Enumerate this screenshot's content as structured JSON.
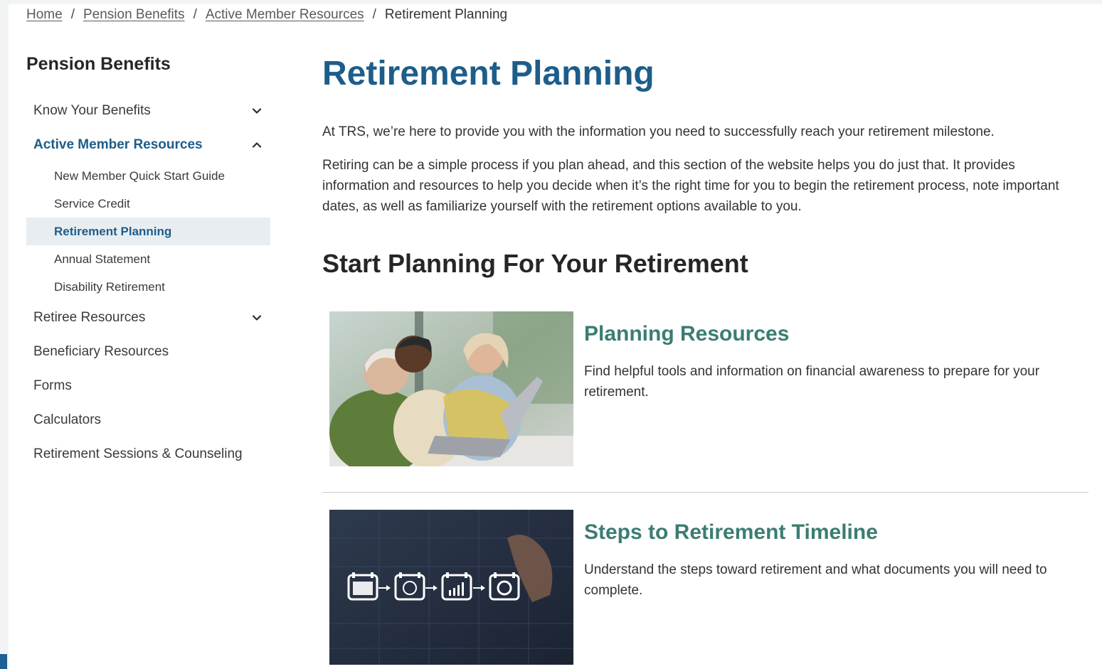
{
  "breadcrumb": {
    "items": [
      "Home",
      "Pension Benefits",
      "Active Member Resources"
    ],
    "current": "Retirement Planning"
  },
  "sidebar": {
    "title": "Pension Benefits",
    "items": [
      {
        "label": "Know Your Benefits",
        "icon": "chevron-down-icon"
      },
      {
        "label": "Active Member Resources",
        "icon": "chevron-up-icon",
        "expanded": true
      },
      {
        "label": "Retiree Resources",
        "icon": "chevron-down-icon"
      },
      {
        "label": "Beneficiary Resources"
      },
      {
        "label": "Forms"
      },
      {
        "label": "Calculators"
      },
      {
        "label": "Retirement Sessions & Counseling"
      }
    ],
    "subitems": [
      {
        "label": "New Member Quick Start Guide"
      },
      {
        "label": "Service Credit"
      },
      {
        "label": "Retirement Planning",
        "current": true
      },
      {
        "label": "Annual Statement"
      },
      {
        "label": "Disability Retirement"
      }
    ]
  },
  "main": {
    "title": "Retirement Planning",
    "intro": "At TRS, we’re here to provide you with the information you need to successfully reach your retirement milestone.",
    "intro2": "Retiring can be a simple process if you plan ahead, and this section of the website helps you do just that. It provides information and resources to help you decide when it’s the right time for you to begin the retirement process, note important dates, as well as familiarize yourself with the retirement options available to you.",
    "section_title": "Start Planning For Your Retirement",
    "cards": [
      {
        "title": "Planning Resources",
        "description": "Find helpful tools and information on financial awareness to prepare for your retirement.",
        "image": "seniors-with-laptop-photo"
      },
      {
        "title": "Steps to Retirement Timeline",
        "description": "Understand the steps toward retirement and what documents you will need to complete.",
        "image": "timeline-icons-photo"
      }
    ]
  },
  "colors": {
    "brand_blue": "#1d5d8a",
    "card_title_teal": "#3b7d72",
    "current_bg": "#e8edf2"
  }
}
